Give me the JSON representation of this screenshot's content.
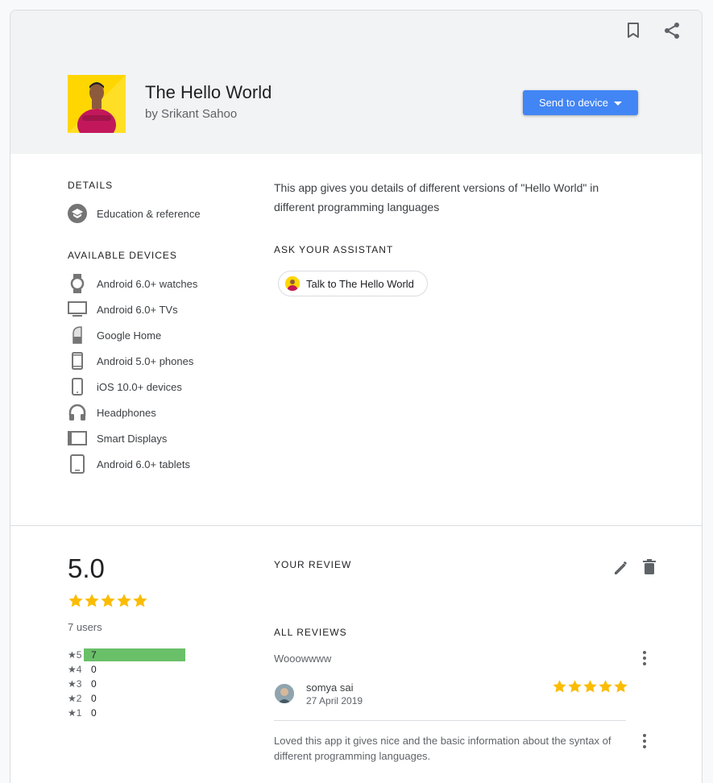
{
  "app": {
    "title": "The Hello World",
    "author": "by Srikant Sahoo",
    "send_button": "Send to device"
  },
  "details": {
    "heading": "DETAILS",
    "category": "Education & reference",
    "category_icon": "graduation-cap-icon"
  },
  "devices": {
    "heading": "AVAILABLE DEVICES",
    "items": [
      {
        "label": "Android 6.0+ watches",
        "icon": "watch-icon"
      },
      {
        "label": "Android 6.0+ TVs",
        "icon": "tv-icon"
      },
      {
        "label": "Google Home",
        "icon": "speaker-icon"
      },
      {
        "label": "Android 5.0+ phones",
        "icon": "phone-icon"
      },
      {
        "label": "iOS 10.0+ devices",
        "icon": "iphone-icon"
      },
      {
        "label": "Headphones",
        "icon": "headphones-icon"
      },
      {
        "label": "Smart Displays",
        "icon": "display-icon"
      },
      {
        "label": "Android 6.0+ tablets",
        "icon": "tablet-icon"
      }
    ]
  },
  "description": "This app gives you details of different versions of \"Hello World\" in different programming languages",
  "assistant": {
    "heading": "ASK YOUR ASSISTANT",
    "chip_label": "Talk to The Hello World"
  },
  "ratings": {
    "average": "5.0",
    "stars": 5,
    "users": "7 users",
    "histogram": [
      {
        "label": "5",
        "count": "7",
        "fraction": 1.0
      },
      {
        "label": "4",
        "count": "0",
        "fraction": 0
      },
      {
        "label": "3",
        "count": "0",
        "fraction": 0
      },
      {
        "label": "2",
        "count": "0",
        "fraction": 0
      },
      {
        "label": "1",
        "count": "0",
        "fraction": 0
      }
    ]
  },
  "your_review": {
    "heading": "YOUR REVIEW"
  },
  "all_reviews": {
    "heading": "ALL REVIEWS",
    "items": [
      {
        "text": "Wooowwww",
        "author": "somya sai",
        "date": "27 April 2019",
        "stars": 5
      },
      {
        "text": "Loved this app it gives nice and the basic information about the syntax of different programming languages."
      }
    ]
  },
  "colors": {
    "accent": "#4285f4",
    "star": "#fbbc04",
    "bar": "#6abf69"
  }
}
